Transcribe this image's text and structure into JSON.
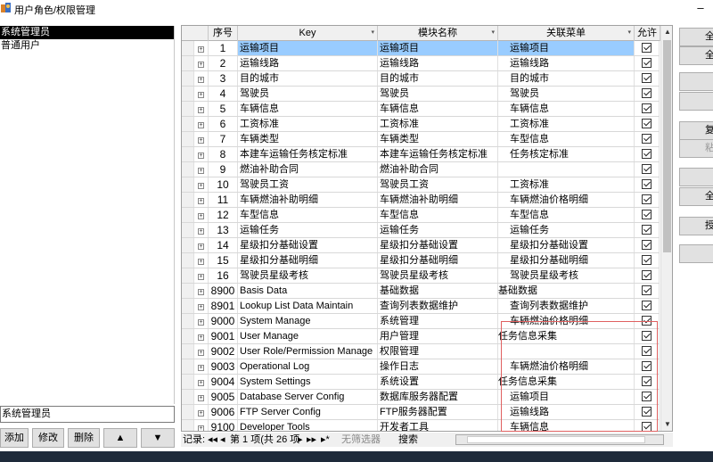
{
  "window": {
    "title": "用户角色/权限管理",
    "min_glyph": "–"
  },
  "roles": {
    "items": [
      "系统管理员",
      "普通用户"
    ],
    "selected_index": 0,
    "input_value": "系统管理员"
  },
  "left_buttons": {
    "add": "添加",
    "edit": "修改",
    "delete": "删除",
    "up": "▲",
    "down": "▼"
  },
  "grid": {
    "columns": {
      "seq": "序号",
      "key": "Key",
      "module": "模块名称",
      "menu": "关联菜单",
      "allow": "允许"
    },
    "sort_glyph": "▾",
    "expand_glyph": "+",
    "selected_row": 0,
    "rows": [
      {
        "seq": "1",
        "key": "运输项目",
        "module": "运输项目",
        "menu": "运输项目",
        "allow": true
      },
      {
        "seq": "2",
        "key": "运输线路",
        "module": "运输线路",
        "menu": "运输线路",
        "allow": true
      },
      {
        "seq": "3",
        "key": "目的城市",
        "module": "目的城市",
        "menu": "目的城市",
        "allow": true
      },
      {
        "seq": "4",
        "key": "驾驶员",
        "module": "驾驶员",
        "menu": "驾驶员",
        "allow": true
      },
      {
        "seq": "5",
        "key": "车辆信息",
        "module": "车辆信息",
        "menu": "车辆信息",
        "allow": true
      },
      {
        "seq": "6",
        "key": "工资标准",
        "module": "工资标准",
        "menu": "工资标准",
        "allow": true
      },
      {
        "seq": "7",
        "key": "车辆类型",
        "module": "车辆类型",
        "menu": "车型信息",
        "allow": true
      },
      {
        "seq": "8",
        "key": "本建车运输任务核定标准",
        "module": "本建车运输任务核定标准",
        "menu": "任务核定标准",
        "allow": true
      },
      {
        "seq": "9",
        "key": "燃油补助合同",
        "module": "燃油补助合同",
        "menu": "",
        "allow": true
      },
      {
        "seq": "10",
        "key": "驾驶员工资",
        "module": "驾驶员工资",
        "menu": "工资标准",
        "allow": true
      },
      {
        "seq": "11",
        "key": "车辆燃油补助明细",
        "module": "车辆燃油补助明细",
        "menu": "车辆燃油价格明细",
        "allow": true
      },
      {
        "seq": "12",
        "key": "车型信息",
        "module": "车型信息",
        "menu": "车型信息",
        "allow": true
      },
      {
        "seq": "13",
        "key": "运输任务",
        "module": "运输任务",
        "menu": "运输任务",
        "allow": true
      },
      {
        "seq": "14",
        "key": "星级扣分基础设置",
        "module": "星级扣分基础设置",
        "menu": "星级扣分基础设置",
        "allow": true
      },
      {
        "seq": "15",
        "key": "星级扣分基础明细",
        "module": "星级扣分基础明细",
        "menu": "星级扣分基础明细",
        "allow": true
      },
      {
        "seq": "16",
        "key": "驾驶员星级考核",
        "module": "驾驶员星级考核",
        "menu": "驾驶员星级考核",
        "allow": true
      },
      {
        "seq": "8900",
        "key": "Basis Data",
        "module": "基础数据",
        "menu": "基础数据",
        "allow": true
      },
      {
        "seq": "8901",
        "key": "Lookup List Data Maintain",
        "module": "查询列表数据维护",
        "menu": "查询列表数据维护",
        "allow": true
      },
      {
        "seq": "9000",
        "key": "System Manage",
        "module": "系统管理",
        "menu": "车辆燃油价格明细",
        "allow": true
      },
      {
        "seq": "9001",
        "key": "User Manage",
        "module": "用户管理",
        "menu": "任务信息采集",
        "allow": true
      },
      {
        "seq": "9002",
        "key": "User Role/Permission Manage",
        "module": "权限管理",
        "menu": "",
        "allow": true
      },
      {
        "seq": "9003",
        "key": "Operational Log",
        "module": "操作日志",
        "menu": "车辆燃油价格明细",
        "allow": true
      },
      {
        "seq": "9004",
        "key": "System Settings",
        "module": "系统设置",
        "menu": "任务信息采集",
        "allow": true
      },
      {
        "seq": "9005",
        "key": "Database Server Config",
        "module": "数据库服务器配置",
        "menu": "运输项目",
        "allow": true
      },
      {
        "seq": "9006",
        "key": "FTP Server Config",
        "module": "FTP服务器配置",
        "menu": "运输线路",
        "allow": true
      },
      {
        "seq": "9100",
        "key": "Developer Tools",
        "module": "开发者工具",
        "menu": "车辆信息",
        "allow": true
      }
    ]
  },
  "status_bar": {
    "record_label": "记录:",
    "nav_first": "◂◂",
    "nav_prev": "◂",
    "position_text": "第 1 项(共 26 项",
    "nav_next": "▸",
    "nav_last": "▸▸",
    "nav_new": "▸*",
    "filter_text": "无筛选器",
    "search_text": "搜索"
  },
  "right_buttons": [
    "全",
    "全",
    "",
    "",
    "复",
    "粘",
    "",
    "全",
    "授",
    ""
  ],
  "colors": {
    "selection": "#99ccff",
    "highlight_box": "#e06060"
  }
}
